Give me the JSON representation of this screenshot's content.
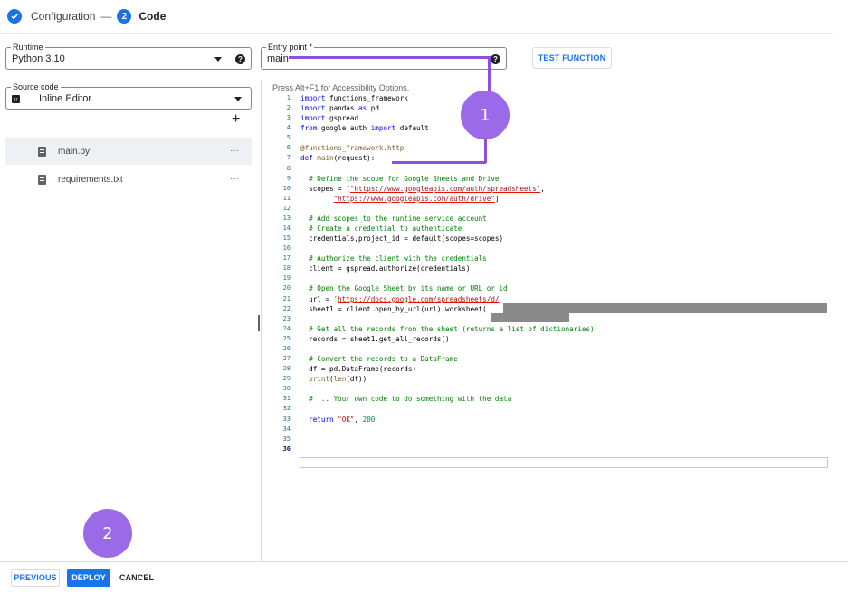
{
  "stepper": {
    "step1_label": "Configuration",
    "separator": "—",
    "step2_number": "2",
    "step2_label": "Code"
  },
  "runtime": {
    "label": "Runtime",
    "value": "Python 3.10"
  },
  "source_code": {
    "label": "Source code",
    "value": "Inline Editor"
  },
  "entry_point": {
    "label": "Entry point *",
    "value": "main"
  },
  "test_button": "TEST FUNCTION",
  "add_file": "+",
  "files": [
    {
      "name": "main.py",
      "menu": "···",
      "selected": true
    },
    {
      "name": "requirements.txt",
      "menu": "···",
      "selected": false
    }
  ],
  "editor": {
    "accessibility_hint": "Press Alt+F1 for Accessibility Options.",
    "line_numbers": [
      "1",
      "2",
      "3",
      "4",
      "5",
      "6",
      "7",
      "8",
      "9",
      "10",
      "11",
      "12",
      "13",
      "14",
      "15",
      "16",
      "17",
      "18",
      "19",
      "20",
      "21",
      "22",
      "23",
      "24",
      "25",
      "26",
      "27",
      "28",
      "29",
      "30",
      "31",
      "32",
      "33",
      "34",
      "35",
      "36"
    ]
  },
  "annotations": {
    "badge1": "1",
    "badge2": "2",
    "color": "#8c4fe0"
  },
  "footer": {
    "previous": "PREVIOUS",
    "deploy": "DEPLOY",
    "cancel": "CANCEL"
  },
  "colors": {
    "accent": "#1a73e8",
    "annotation": "#9b6ae8"
  }
}
